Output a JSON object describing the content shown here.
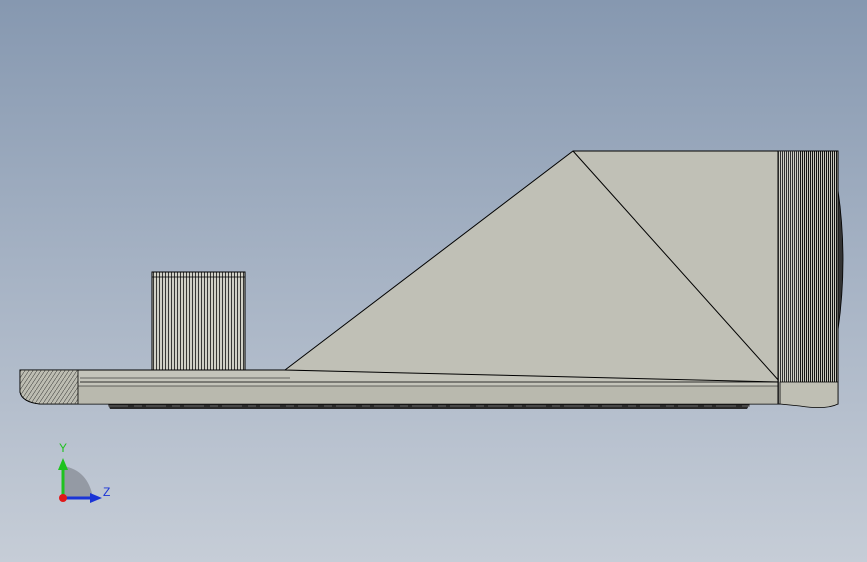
{
  "app": "CAD viewport",
  "view": {
    "name": "right-side-view",
    "colors": {
      "background_top": "#8698b0",
      "background_bottom": "#c6cdd7",
      "part_face": "#c0c0b6",
      "part_face_shade": "#b5b5aa",
      "edge": "#000000"
    }
  },
  "triad": {
    "y_label": "Y",
    "z_label": "Z",
    "y_color": "#1fc21f",
    "z_color": "#1a34d6",
    "origin_color": "#e01818"
  }
}
